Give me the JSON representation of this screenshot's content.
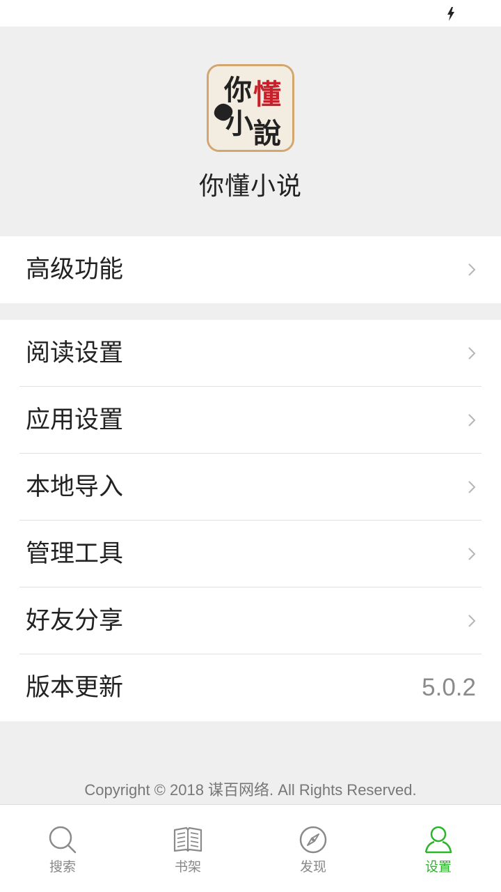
{
  "app": {
    "name": "你懂小说",
    "logo_text": [
      "你",
      "懂",
      "小",
      "說"
    ]
  },
  "menu_group_1": [
    {
      "label": "高级功能",
      "icon": "chevron-right-icon"
    }
  ],
  "menu_group_2": [
    {
      "label": "阅读设置",
      "icon": "chevron-right-icon"
    },
    {
      "label": "应用设置",
      "icon": "chevron-right-icon"
    },
    {
      "label": "本地导入",
      "icon": "chevron-right-icon"
    },
    {
      "label": "管理工具",
      "icon": "chevron-right-icon"
    },
    {
      "label": "好友分享",
      "icon": "chevron-right-icon"
    },
    {
      "label": "版本更新",
      "value": "5.0.2"
    }
  ],
  "copyright": "Copyright © 2018 谋百网络. All Rights Reserved.",
  "tabbar": {
    "tabs": [
      {
        "label": "搜索",
        "icon": "search-icon",
        "active": false
      },
      {
        "label": "书架",
        "icon": "book-icon",
        "active": false
      },
      {
        "label": "发现",
        "icon": "compass-icon",
        "active": false
      },
      {
        "label": "设置",
        "icon": "user-icon",
        "active": true
      }
    ]
  },
  "colors": {
    "accent": "#2bb52b",
    "background": "#efefef",
    "logo_border": "#d4a66f",
    "logo_red": "#c8202a"
  }
}
